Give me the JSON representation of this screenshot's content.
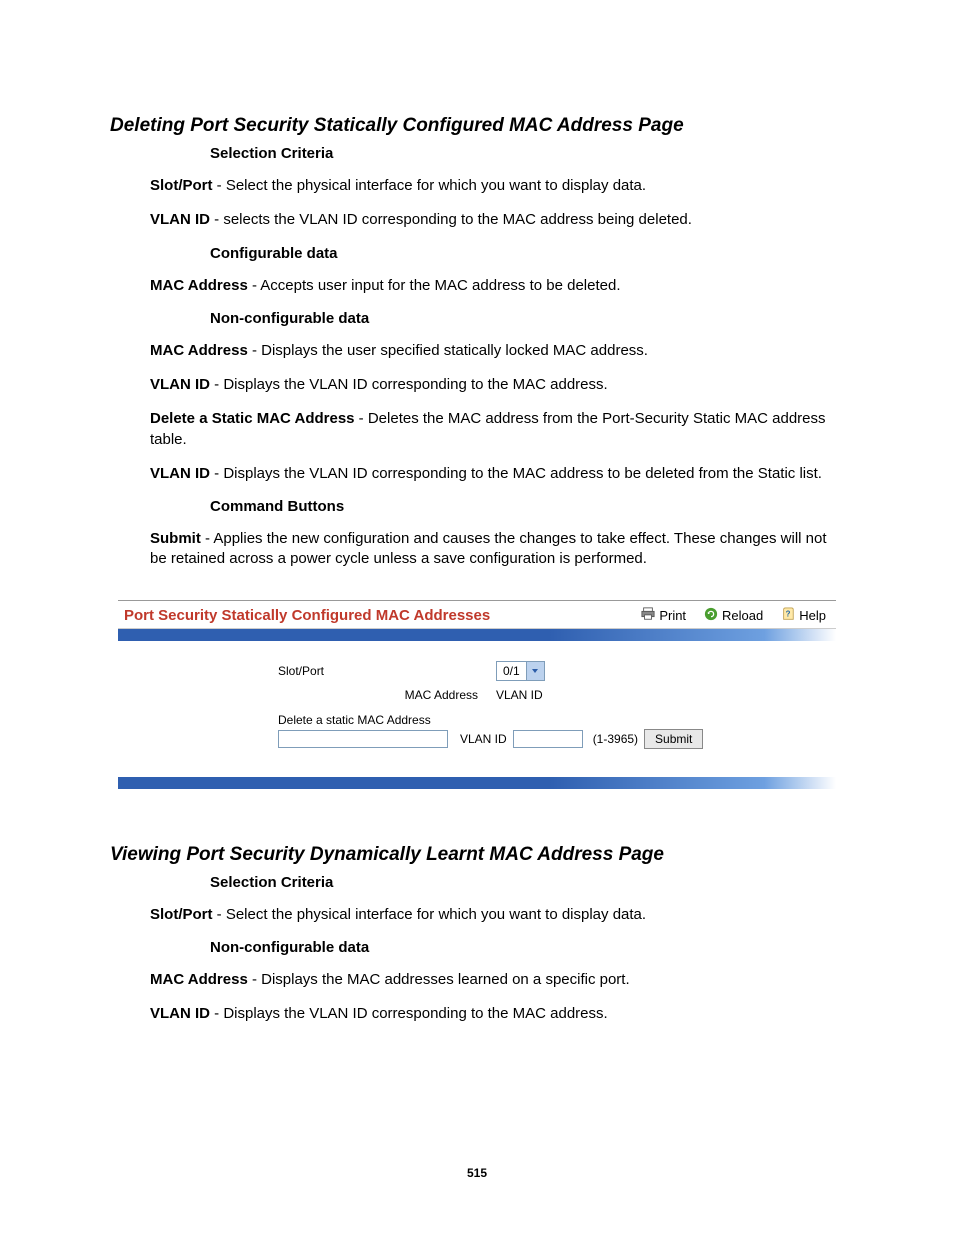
{
  "section1": {
    "heading": "Deleting Port Security Statically Configured MAC Address Page",
    "sub_selection": "Selection Criteria",
    "slot_port": {
      "bold": "Slot/Port",
      "text": " - Select the physical interface for which you want to display data."
    },
    "vlan_id_sel": {
      "bold": "VLAN ID",
      "text": " - selects the VLAN ID corresponding to the MAC address being deleted."
    },
    "sub_configurable": "Configurable data",
    "mac_address_cfg": {
      "bold": "MAC Address",
      "text": " - Accepts user input for the MAC address to be deleted."
    },
    "sub_nonconfig": "Non-configurable data",
    "mac_address_nc": {
      "bold": "MAC Address",
      "text": " - Displays the user specified statically locked MAC address."
    },
    "vlan_id_nc": {
      "bold": "VLAN ID",
      "text": " - Displays the VLAN ID corresponding to the MAC address."
    },
    "delete_static": {
      "bold": "Delete a Static MAC Address",
      "text": " - Deletes the MAC address from the Port-Security Static MAC address table."
    },
    "vlan_id_del": {
      "bold": "VLAN ID",
      "text": " - Displays the VLAN ID corresponding to the MAC address to be deleted from the Static list."
    },
    "sub_commands": "Command Buttons",
    "submit": {
      "bold": "Submit",
      "text": " - Applies the new configuration and causes the changes to take effect. These changes will not be retained across a power cycle unless a save configuration is performed."
    }
  },
  "panel": {
    "title": "Port Security Statically Configured MAC Addresses",
    "toolbar": {
      "print": "Print",
      "reload": "Reload",
      "help": "Help"
    },
    "labels": {
      "slot_port": "Slot/Port",
      "mac_address": "MAC Address",
      "vlan_id": "VLAN ID",
      "delete_static": "Delete a static MAC Address",
      "range": "(1-3965)"
    },
    "values": {
      "slot_port": "0/1"
    },
    "buttons": {
      "submit": "Submit"
    }
  },
  "section2": {
    "heading": "Viewing Port Security Dynamically Learnt MAC Address Page",
    "sub_selection": "Selection Criteria",
    "slot_port": {
      "bold": "Slot/Port",
      "text": " - Select the physical interface for which you want to display data."
    },
    "sub_nonconfig": "Non-configurable data",
    "mac_address": {
      "bold": "MAC Address",
      "text": " - Displays the MAC addresses learned on a specific port."
    },
    "vlan_id": {
      "bold": "VLAN ID",
      "text": " - Displays the VLAN ID corresponding to the MAC address."
    }
  },
  "page_number": "515"
}
